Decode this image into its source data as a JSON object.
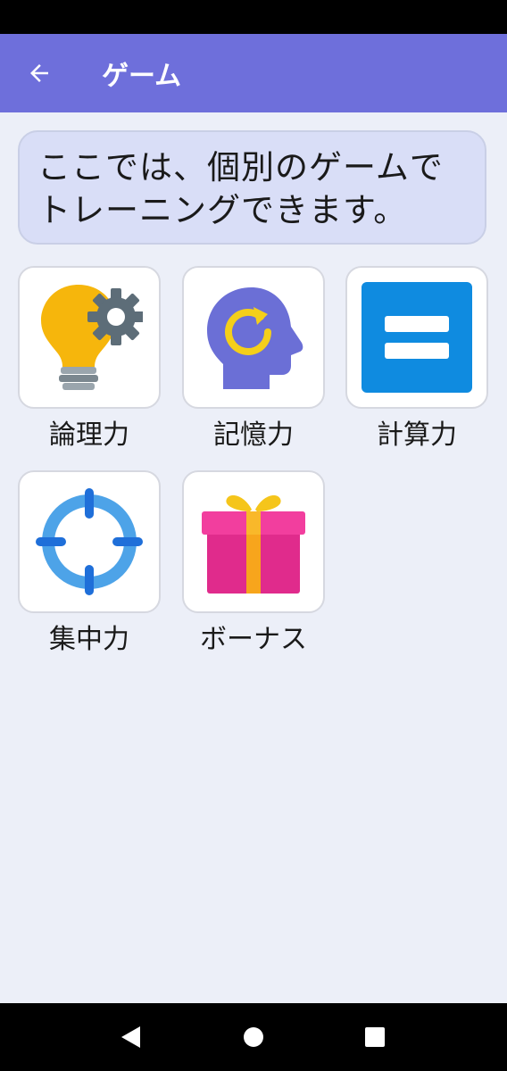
{
  "app_bar": {
    "title": "ゲーム",
    "back_icon": "arrow-left-icon",
    "background": "#6e6fdb"
  },
  "banner": {
    "line1": "ここでは、個別のゲームで",
    "line2": "トレーニングできます。"
  },
  "games": [
    {
      "label": "論理力",
      "icon": "lightbulb-gear-icon"
    },
    {
      "label": "記憶力",
      "icon": "head-refresh-icon"
    },
    {
      "label": "計算力",
      "icon": "equals-icon"
    },
    {
      "label": "集中力",
      "icon": "crosshair-icon"
    },
    {
      "label": "ボーナス",
      "icon": "gift-icon"
    }
  ],
  "nav_bar": {
    "back": "nav-back-icon",
    "home": "nav-home-icon",
    "recents": "nav-recents-icon"
  }
}
